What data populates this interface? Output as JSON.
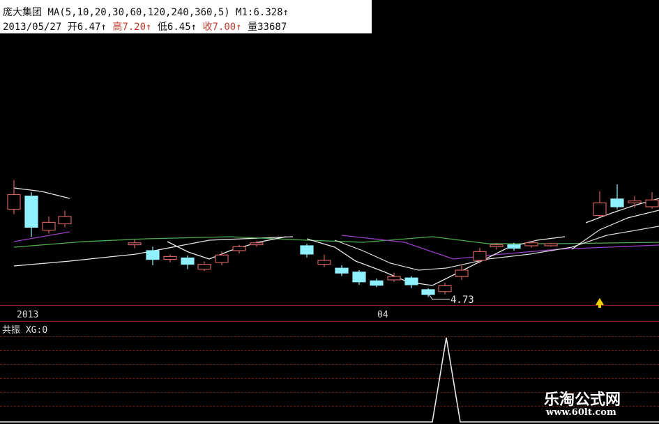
{
  "header": {
    "stock_name": "庞大集团",
    "ma_params": "MA(5,10,20,30,60,120,240,360,5)",
    "m1_label": "M1:6.328",
    "m1_arrow": "↑",
    "date": "2013/05/27",
    "open_label": "开",
    "open_value": "6.47",
    "high_label": "高",
    "high_value": "7.20",
    "low_label": "低",
    "low_value": "6.45",
    "close_label": "收",
    "close_value": "7.00",
    "vol_label": "量",
    "vol_value": "33687",
    "arrow": "↑"
  },
  "chart": {
    "low_marker": "4.73",
    "x_axis": [
      "2013",
      "04"
    ],
    "colors": {
      "up": "#d06060",
      "down": "#8ff0ff",
      "ma_white": "#e8e8e8",
      "ma_green": "#4fae4f",
      "ma_purple": "#9b3fc6",
      "marker": "#f0d000"
    }
  },
  "indicator": {
    "title": "共振",
    "xg_label": "XG:0"
  },
  "watermark": {
    "name": "乐淘公式网",
    "url": "www.60lt.com"
  },
  "chart_data": [
    {
      "type": "candlestick",
      "candles": [
        {
          "o": 6.35,
          "c": 6.65,
          "h": 6.95,
          "l": 6.25
        },
        {
          "o": 6.62,
          "c": 5.98,
          "h": 6.7,
          "l": 5.78
        },
        {
          "o": 5.92,
          "c": 6.08,
          "h": 6.2,
          "l": 5.85
        },
        {
          "o": 6.05,
          "c": 6.2,
          "h": 6.32,
          "l": 5.98
        },
        {
          "o": 5.62,
          "c": 5.66,
          "h": 5.72,
          "l": 5.55
        },
        {
          "o": 5.5,
          "c": 5.32,
          "h": 5.58,
          "l": 5.2
        },
        {
          "o": 5.32,
          "c": 5.38,
          "h": 5.42,
          "l": 5.26
        },
        {
          "o": 5.35,
          "c": 5.22,
          "h": 5.4,
          "l": 5.12
        },
        {
          "o": 5.12,
          "c": 5.22,
          "h": 5.28,
          "l": 5.08
        },
        {
          "o": 5.26,
          "c": 5.41,
          "h": 5.48,
          "l": 5.2
        },
        {
          "o": 5.5,
          "c": 5.58,
          "h": 5.62,
          "l": 5.44
        },
        {
          "o": 5.62,
          "c": 5.66,
          "h": 5.7,
          "l": 5.58
        },
        {
          "o": 5.6,
          "c": 5.43,
          "h": 5.64,
          "l": 5.36
        },
        {
          "o": 5.22,
          "c": 5.3,
          "h": 5.42,
          "l": 5.16
        },
        {
          "o": 5.14,
          "c": 5.04,
          "h": 5.2,
          "l": 4.98
        },
        {
          "o": 5.06,
          "c": 4.86,
          "h": 5.1,
          "l": 4.8
        },
        {
          "o": 4.88,
          "c": 4.79,
          "h": 4.93,
          "l": 4.75
        },
        {
          "o": 4.9,
          "c": 4.97,
          "h": 5.05,
          "l": 4.86
        },
        {
          "o": 4.94,
          "c": 4.8,
          "h": 4.98,
          "l": 4.73
        },
        {
          "o": 4.7,
          "c": 4.6,
          "h": 4.73,
          "l": 4.55
        },
        {
          "o": 4.66,
          "c": 4.78,
          "h": 4.84,
          "l": 4.6
        },
        {
          "o": 4.97,
          "c": 5.1,
          "h": 5.22,
          "l": 4.9
        },
        {
          "o": 5.3,
          "c": 5.48,
          "h": 5.56,
          "l": 5.24
        },
        {
          "o": 5.58,
          "c": 5.62,
          "h": 5.66,
          "l": 5.52
        },
        {
          "o": 5.62,
          "c": 5.55,
          "h": 5.66,
          "l": 5.5
        },
        {
          "o": 5.6,
          "c": 5.66,
          "h": 5.68,
          "l": 5.56
        },
        {
          "o": 5.6,
          "c": 5.64,
          "h": 5.66,
          "l": 5.58
        },
        {
          "o": 6.22,
          "c": 6.48,
          "h": 6.72,
          "l": 6.18
        },
        {
          "o": 6.56,
          "c": 6.4,
          "h": 6.86,
          "l": 6.35
        },
        {
          "o": 6.48,
          "c": 6.52,
          "h": 6.62,
          "l": 6.38
        },
        {
          "o": 6.4,
          "c": 6.54,
          "h": 6.7,
          "l": 6.36
        }
      ]
    },
    {
      "type": "line",
      "name": "",
      "x": [
        0,
        1,
        2,
        3,
        4,
        5,
        6,
        7,
        8,
        9,
        10,
        11,
        12
      ],
      "values": [
        0,
        0,
        0,
        0,
        0,
        0,
        0,
        0,
        1,
        0,
        0,
        0,
        0
      ],
      "ylim": [
        0,
        1
      ]
    }
  ]
}
